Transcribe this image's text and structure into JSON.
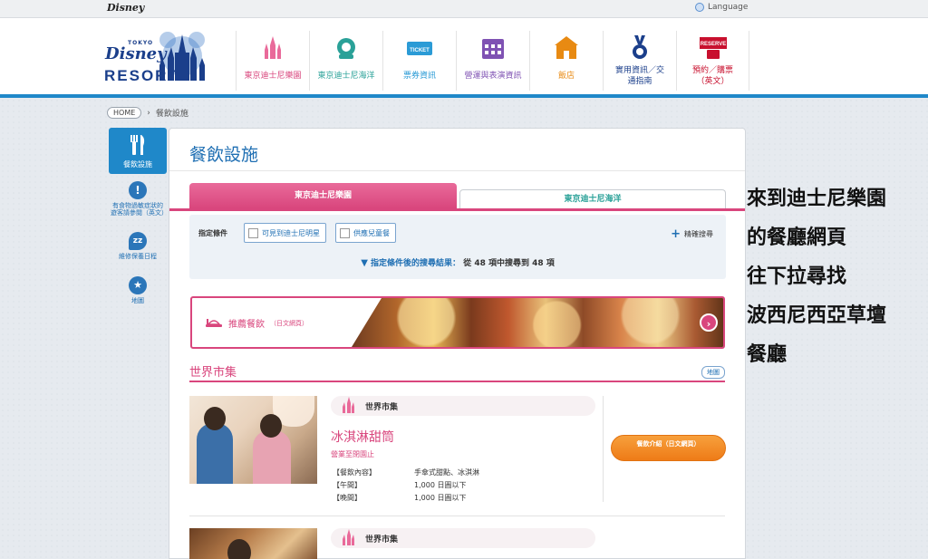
{
  "topbar": {
    "brand": "Disney",
    "language": "Language"
  },
  "logo": {
    "tokyo": "TOKYO",
    "disney": "Disney",
    "resort": "RESORT"
  },
  "nav": [
    {
      "label": "東京迪士尼樂園",
      "color": "#d9467d",
      "icon": "castle-icon"
    },
    {
      "label": "東京迪士尼海洋",
      "color": "#2aa198",
      "icon": "aquasphere-icon"
    },
    {
      "label": "票券資訊",
      "color": "#2b9bd6",
      "icon": "ticket-icon",
      "icon_text": "TICKET"
    },
    {
      "label": "營運與表演資訊",
      "color": "#7f52b3",
      "icon": "calendar-icon"
    },
    {
      "label": "飯店",
      "color": "#e88a12",
      "icon": "hotel-icon"
    },
    {
      "label": "實用資訊／交通指南",
      "color": "#1b3f8b",
      "icon": "info-medal-icon"
    },
    {
      "label": "預約／購票（英文）",
      "color": "#c8102e",
      "icon": "reserve-icon",
      "icon_text": "RESERVE"
    }
  ],
  "breadcrumb": {
    "home": "HOME",
    "sep": "›",
    "current": "餐飲設施"
  },
  "sidebar": {
    "active": {
      "label": "餐飲設施",
      "icon": "fork-knife-icon"
    },
    "items": [
      {
        "label": "有食物過敏症狀的遊客請參閱（英文）",
        "icon": "exclamation-icon",
        "glyph": "!"
      },
      {
        "label": "維修保養日程",
        "icon": "zzz-icon",
        "glyph": "zz"
      },
      {
        "label": "地圖",
        "icon": "map-pin-icon",
        "glyph": "★"
      }
    ]
  },
  "panel": {
    "title": "餐飲設施",
    "tabs": [
      {
        "label": "東京迪士尼樂園",
        "active": true
      },
      {
        "label": "東京迪士尼海洋",
        "active": false
      }
    ],
    "filter": {
      "label": "指定條件",
      "options": [
        "可見到迪士尼明星",
        "供應兒童餐"
      ],
      "advanced": "精確搜尋",
      "result_prefix": "指定條件後的搜尋結果：",
      "result_count": "從 48 項中搜尋到 48 項"
    },
    "banner": {
      "label": "推薦餐飲",
      "sub": "（日文網頁）"
    },
    "section": {
      "title": "世界市集",
      "map": "地圖"
    },
    "restaurants": [
      {
        "area": "世界市集",
        "name": "冰淇淋甜筒",
        "status": "營業至閉園止",
        "rows": [
          {
            "k": "【餐飲內容】",
            "v": "手傘式甜點、冰淇淋"
          },
          {
            "k": "【午間】",
            "v": "1,000 日圓以下"
          },
          {
            "k": "【晚間】",
            "v": "1,000 日圓以下"
          }
        ],
        "button": "餐飲介紹（日文網頁）"
      },
      {
        "area": "世界市集"
      }
    ]
  },
  "annotation": [
    "來到迪士尼樂園",
    "的餐廳網頁",
    "往下拉尋找",
    "波西尼西亞草壇",
    "餐廳"
  ]
}
